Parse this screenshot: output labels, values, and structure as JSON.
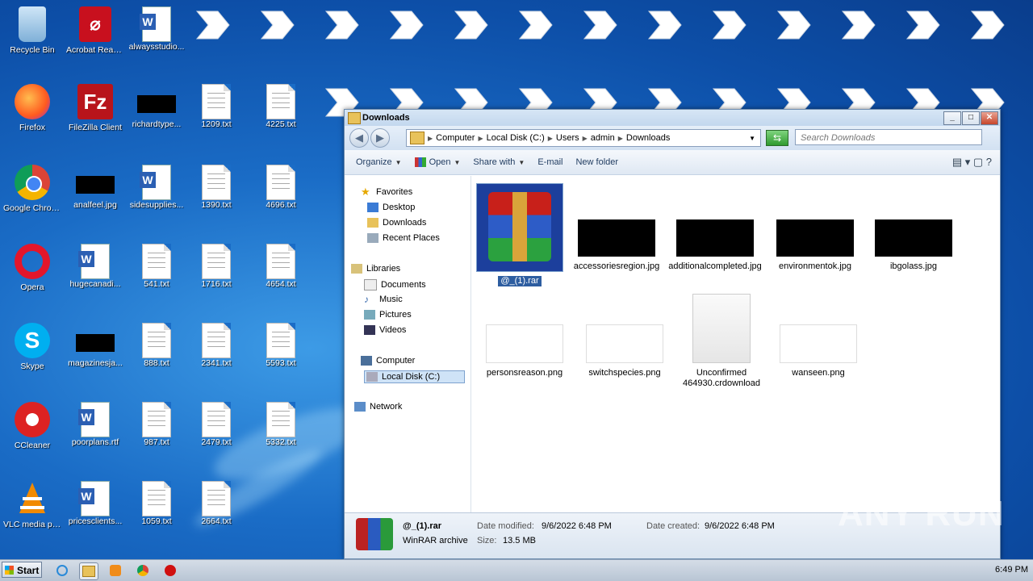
{
  "desktop": {
    "icons": [
      {
        "label": "Recycle Bin",
        "type": "recycle",
        "col": 0,
        "row": 0
      },
      {
        "label": "Acrobat Reader DC",
        "type": "acrobat",
        "col": 1,
        "row": 0
      },
      {
        "label": "alwaysstudio...",
        "type": "doc",
        "col": 2,
        "row": 0
      },
      {
        "label": "Firefox",
        "type": "firefox",
        "col": 0,
        "row": 1
      },
      {
        "label": "FileZilla Client",
        "type": "filezilla",
        "col": 1,
        "row": 1
      },
      {
        "label": "richardtype...",
        "type": "black",
        "col": 2,
        "row": 1
      },
      {
        "label": "1209.txt",
        "type": "txt",
        "col": 3,
        "row": 1
      },
      {
        "label": "4225.txt",
        "type": "txt",
        "col": 4,
        "row": 1
      },
      {
        "label": "Google Chrome",
        "type": "chrome",
        "col": 0,
        "row": 2
      },
      {
        "label": "analfeel.jpg",
        "type": "black",
        "col": 1,
        "row": 2
      },
      {
        "label": "sidesupplies...",
        "type": "doc",
        "col": 2,
        "row": 2
      },
      {
        "label": "1390.txt",
        "type": "txt",
        "col": 3,
        "row": 2
      },
      {
        "label": "4696.txt",
        "type": "txt",
        "col": 4,
        "row": 2
      },
      {
        "label": "Opera",
        "type": "opera",
        "col": 0,
        "row": 3
      },
      {
        "label": "hugecanadi...",
        "type": "doc",
        "col": 1,
        "row": 3
      },
      {
        "label": "541.txt",
        "type": "txt",
        "col": 2,
        "row": 3
      },
      {
        "label": "1716.txt",
        "type": "txt",
        "col": 3,
        "row": 3
      },
      {
        "label": "4654.txt",
        "type": "txt",
        "col": 4,
        "row": 3
      },
      {
        "label": "Skype",
        "type": "skype",
        "col": 0,
        "row": 4
      },
      {
        "label": "magazinesja...",
        "type": "black",
        "col": 1,
        "row": 4
      },
      {
        "label": "888.txt",
        "type": "txt",
        "col": 2,
        "row": 4
      },
      {
        "label": "2341.txt",
        "type": "txt",
        "col": 3,
        "row": 4
      },
      {
        "label": "5593.txt",
        "type": "txt",
        "col": 4,
        "row": 4
      },
      {
        "label": "CCleaner",
        "type": "ccleaner",
        "col": 0,
        "row": 5
      },
      {
        "label": "poorplans.rtf",
        "type": "doc",
        "col": 1,
        "row": 5
      },
      {
        "label": "987.txt",
        "type": "txt",
        "col": 2,
        "row": 5
      },
      {
        "label": "2479.txt",
        "type": "txt",
        "col": 3,
        "row": 5
      },
      {
        "label": "5332.txt",
        "type": "txt",
        "col": 4,
        "row": 5
      },
      {
        "label": "VLC media player",
        "type": "vlc",
        "col": 0,
        "row": 6
      },
      {
        "label": "pricesclients...",
        "type": "doc",
        "col": 1,
        "row": 6
      },
      {
        "label": "1059.txt",
        "type": "txt",
        "col": 2,
        "row": 6
      },
      {
        "label": "2664.txt",
        "type": "txt",
        "col": 3,
        "row": 6
      }
    ]
  },
  "window": {
    "title": "Downloads",
    "address": {
      "crumbs": [
        "Computer",
        "Local Disk (C:)",
        "Users",
        "admin",
        "Downloads"
      ]
    },
    "search_placeholder": "Search Downloads",
    "toolbar": {
      "organize": "Organize",
      "open": "Open",
      "share_with": "Share with",
      "email": "E-mail",
      "new_folder": "New folder"
    },
    "nav": {
      "favorites": "Favorites",
      "desktop": "Desktop",
      "downloads": "Downloads",
      "recent_places": "Recent Places",
      "libraries": "Libraries",
      "documents": "Documents",
      "music": "Music",
      "pictures": "Pictures",
      "videos": "Videos",
      "computer": "Computer",
      "local_disk": "Local Disk (C:)",
      "network": "Network"
    },
    "files": [
      {
        "name": "@_(1).rar",
        "type": "rar",
        "selected": true
      },
      {
        "name": "accessoriesregion.jpg",
        "type": "blackimg"
      },
      {
        "name": "additionalcompleted.jpg",
        "type": "blackimg"
      },
      {
        "name": "environmentok.jpg",
        "type": "blackimg"
      },
      {
        "name": "ibgolass.jpg",
        "type": "blackimg"
      },
      {
        "name": "personsreason.png",
        "type": "whiteimg"
      },
      {
        "name": "switchspecies.png",
        "type": "whiteimg"
      },
      {
        "name": "Unconfirmed 464930.crdownload",
        "type": "blank"
      },
      {
        "name": "wanseen.png",
        "type": "whiteimg"
      }
    ],
    "details": {
      "name": "@_(1).rar",
      "type": "WinRAR archive",
      "date_modified_label": "Date modified:",
      "date_modified": "9/6/2022 6:48 PM",
      "date_created_label": "Date created:",
      "date_created": "9/6/2022 6:48 PM",
      "size_label": "Size:",
      "size": "13.5 MB"
    }
  },
  "taskbar": {
    "start_label": "Start",
    "clock": "6:49 PM"
  },
  "watermark": "ANY RUN"
}
